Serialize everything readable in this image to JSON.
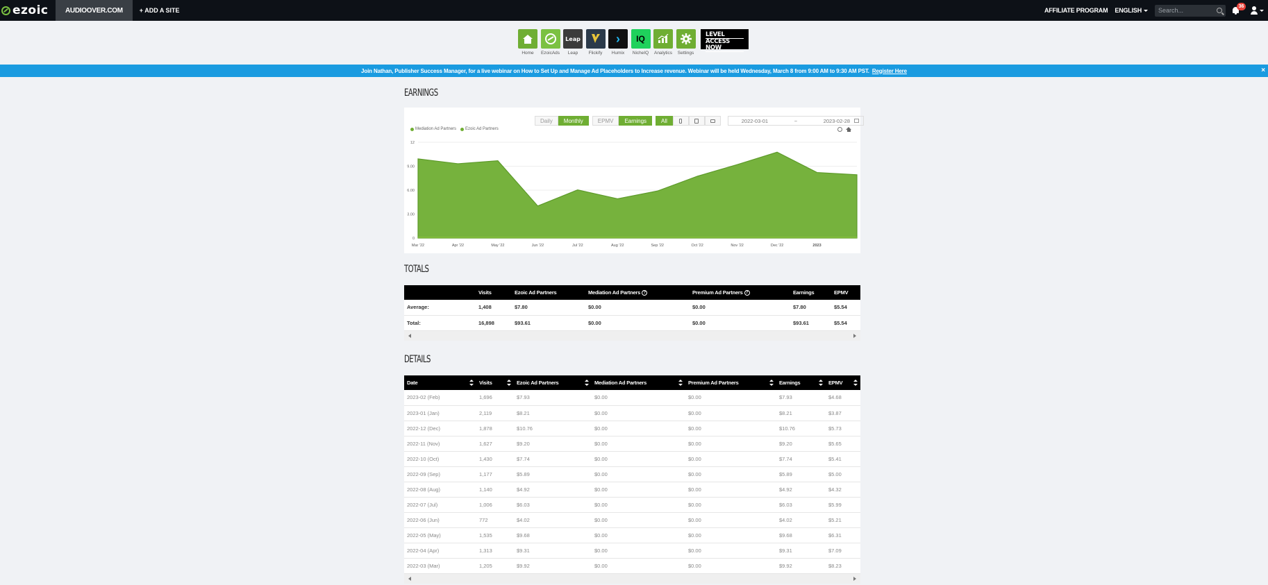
{
  "topbar": {
    "logo": "ezoic",
    "site": "AUDIOOVER.COM",
    "add_site": "+ ADD A SITE",
    "affiliate": "AFFILIATE PROGRAM",
    "language": "ENGLISH",
    "search_placeholder": "Search...",
    "notifications": "36"
  },
  "apps": [
    {
      "label": "Home",
      "color": "#6fae33",
      "glyph": ""
    },
    {
      "label": "EzoicAds",
      "color": "#7bc142",
      "glyph": ""
    },
    {
      "label": "Leap",
      "color": "#3b3b3b",
      "glyph": "Leap"
    },
    {
      "label": "Flickify",
      "color": "#2b3a4a",
      "glyph": ""
    },
    {
      "label": "Humix",
      "color": "#111111",
      "glyph": "›"
    },
    {
      "label": "NicheIQ",
      "color": "#1fd15c",
      "glyph": "IQ"
    },
    {
      "label": "Analytics",
      "color": "#6fae33",
      "glyph": ""
    },
    {
      "label": "Settings",
      "color": "#6fae33",
      "glyph": ""
    }
  ],
  "level_banner": {
    "line1": "LEVEL",
    "line2": "ACCESS NOW"
  },
  "banner": {
    "text": "Join Nathan, Publisher Success Manager, for a live webinar on How to Set Up and Manage Ad Placeholders to Increase revenue. Webinar will be held Wednesday, March 8 from 9:00 AM to 9:30 AM PST.",
    "link": "Register Here",
    "close": "×"
  },
  "earnings": {
    "title": "EARNINGS",
    "buttons": {
      "daily": "Daily",
      "monthly": "Monthly",
      "epmv": "EPMV",
      "earnings": "Earnings",
      "all": "All"
    },
    "date_from": "2022-03-01",
    "date_sep": "~",
    "date_to": "2023-02-28"
  },
  "chart_data": {
    "type": "area",
    "legend": [
      "Mediation Ad Partners",
      "Ezoic Ad Partners"
    ],
    "categories": [
      "Mar '22",
      "Apr '22",
      "May '22",
      "Jun '22",
      "Jul '22",
      "Aug '22",
      "Sep '22",
      "Oct '22",
      "Nov '22",
      "Dec '22",
      "2023",
      ""
    ],
    "series": [
      {
        "name": "Ezoic Ad Partners",
        "values": [
          9.92,
          9.31,
          9.68,
          4.02,
          6.03,
          4.92,
          5.89,
          7.74,
          9.2,
          10.76,
          8.21,
          7.93
        ],
        "color": "#6fae33"
      },
      {
        "name": "Mediation Ad Partners",
        "values": [
          0,
          0,
          0,
          0,
          0,
          0,
          0,
          0,
          0,
          0,
          0,
          0
        ],
        "color": "#8cc63f"
      }
    ],
    "yticks": [
      "0",
      "3.00",
      "6.00",
      "9.00",
      "12"
    ],
    "ylim": [
      0,
      12
    ]
  },
  "totals": {
    "title": "TOTALS",
    "columns": [
      "",
      "Visits",
      "Ezoic Ad Partners",
      "Mediation Ad Partners",
      "Premium Ad Partners",
      "Earnings",
      "EPMV"
    ],
    "rows": [
      [
        "Average:",
        "1,408",
        "$7.80",
        "$0.00",
        "$0.00",
        "$7.80",
        "$5.54"
      ],
      [
        "Total:",
        "16,898",
        "$93.61",
        "$0.00",
        "$0.00",
        "$93.61",
        "$5.54"
      ]
    ]
  },
  "details": {
    "title": "DETAILS",
    "columns": [
      "Date",
      "Visits",
      "Ezoic Ad Partners",
      "Mediation Ad Partners",
      "Premium Ad Partners",
      "Earnings",
      "EPMV"
    ],
    "rows": [
      [
        "2023-02 (Feb)",
        "1,696",
        "$7.93",
        "$0.00",
        "$0.00",
        "$7.93",
        "$4.68"
      ],
      [
        "2023-01 (Jan)",
        "2,119",
        "$8.21",
        "$0.00",
        "$0.00",
        "$8.21",
        "$3.87"
      ],
      [
        "2022-12 (Dec)",
        "1,878",
        "$10.76",
        "$0.00",
        "$0.00",
        "$10.76",
        "$5.73"
      ],
      [
        "2022-11 (Nov)",
        "1,627",
        "$9.20",
        "$0.00",
        "$0.00",
        "$9.20",
        "$5.65"
      ],
      [
        "2022-10 (Oct)",
        "1,430",
        "$7.74",
        "$0.00",
        "$0.00",
        "$7.74",
        "$5.41"
      ],
      [
        "2022-09 (Sep)",
        "1,177",
        "$5.89",
        "$0.00",
        "$0.00",
        "$5.89",
        "$5.00"
      ],
      [
        "2022-08 (Aug)",
        "1,140",
        "$4.92",
        "$0.00",
        "$0.00",
        "$4.92",
        "$4.32"
      ],
      [
        "2022-07 (Jul)",
        "1,006",
        "$6.03",
        "$0.00",
        "$0.00",
        "$6.03",
        "$5.99"
      ],
      [
        "2022-06 (Jun)",
        "772",
        "$4.02",
        "$0.00",
        "$0.00",
        "$4.02",
        "$5.21"
      ],
      [
        "2022-05 (May)",
        "1,535",
        "$9.68",
        "$0.00",
        "$0.00",
        "$9.68",
        "$6.31"
      ],
      [
        "2022-04 (Apr)",
        "1,313",
        "$9.31",
        "$0.00",
        "$0.00",
        "$9.31",
        "$7.09"
      ],
      [
        "2022-03 (Mar)",
        "1,205",
        "$9.92",
        "$0.00",
        "$0.00",
        "$9.92",
        "$8.23"
      ]
    ]
  }
}
